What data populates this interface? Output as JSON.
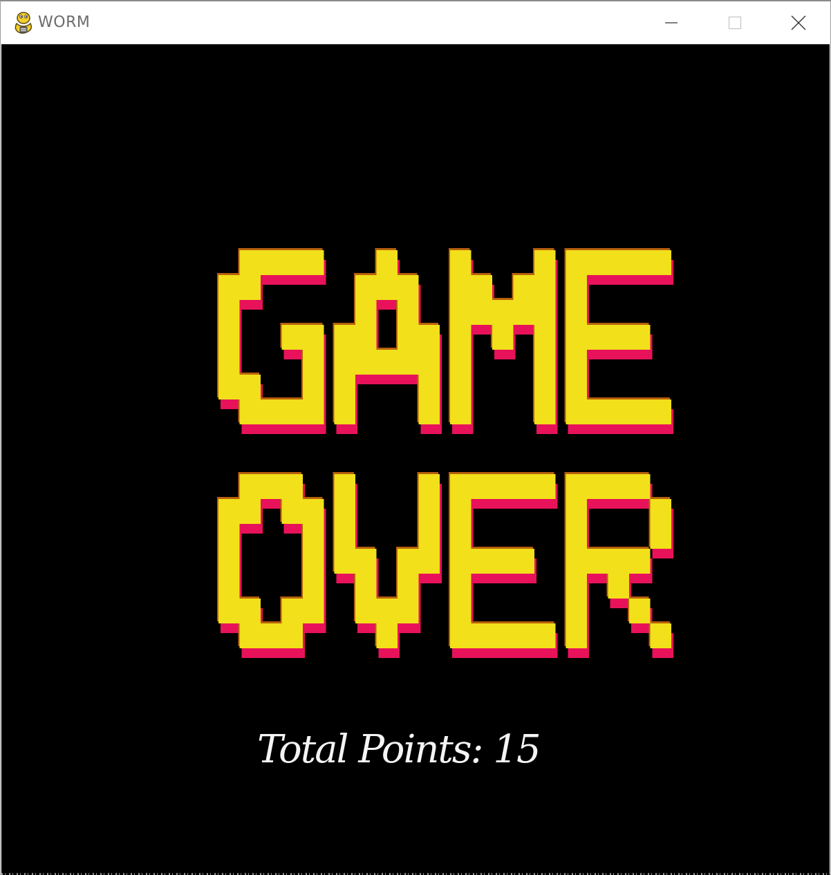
{
  "window": {
    "title": "WORM",
    "controls": {
      "minimize": "minimize-icon",
      "maximize": "maximize-icon",
      "close": "close-icon"
    }
  },
  "game": {
    "headline_line1": "GAME",
    "headline_line2": "OVER",
    "score_label": "Total Points:",
    "score_value": "15",
    "colors": {
      "background": "#000000",
      "letter_fill": "#f2e01a",
      "letter_shadow": "#e8125a",
      "letter_edge": "#b8600a",
      "score_text": "#f4f4f4"
    }
  }
}
